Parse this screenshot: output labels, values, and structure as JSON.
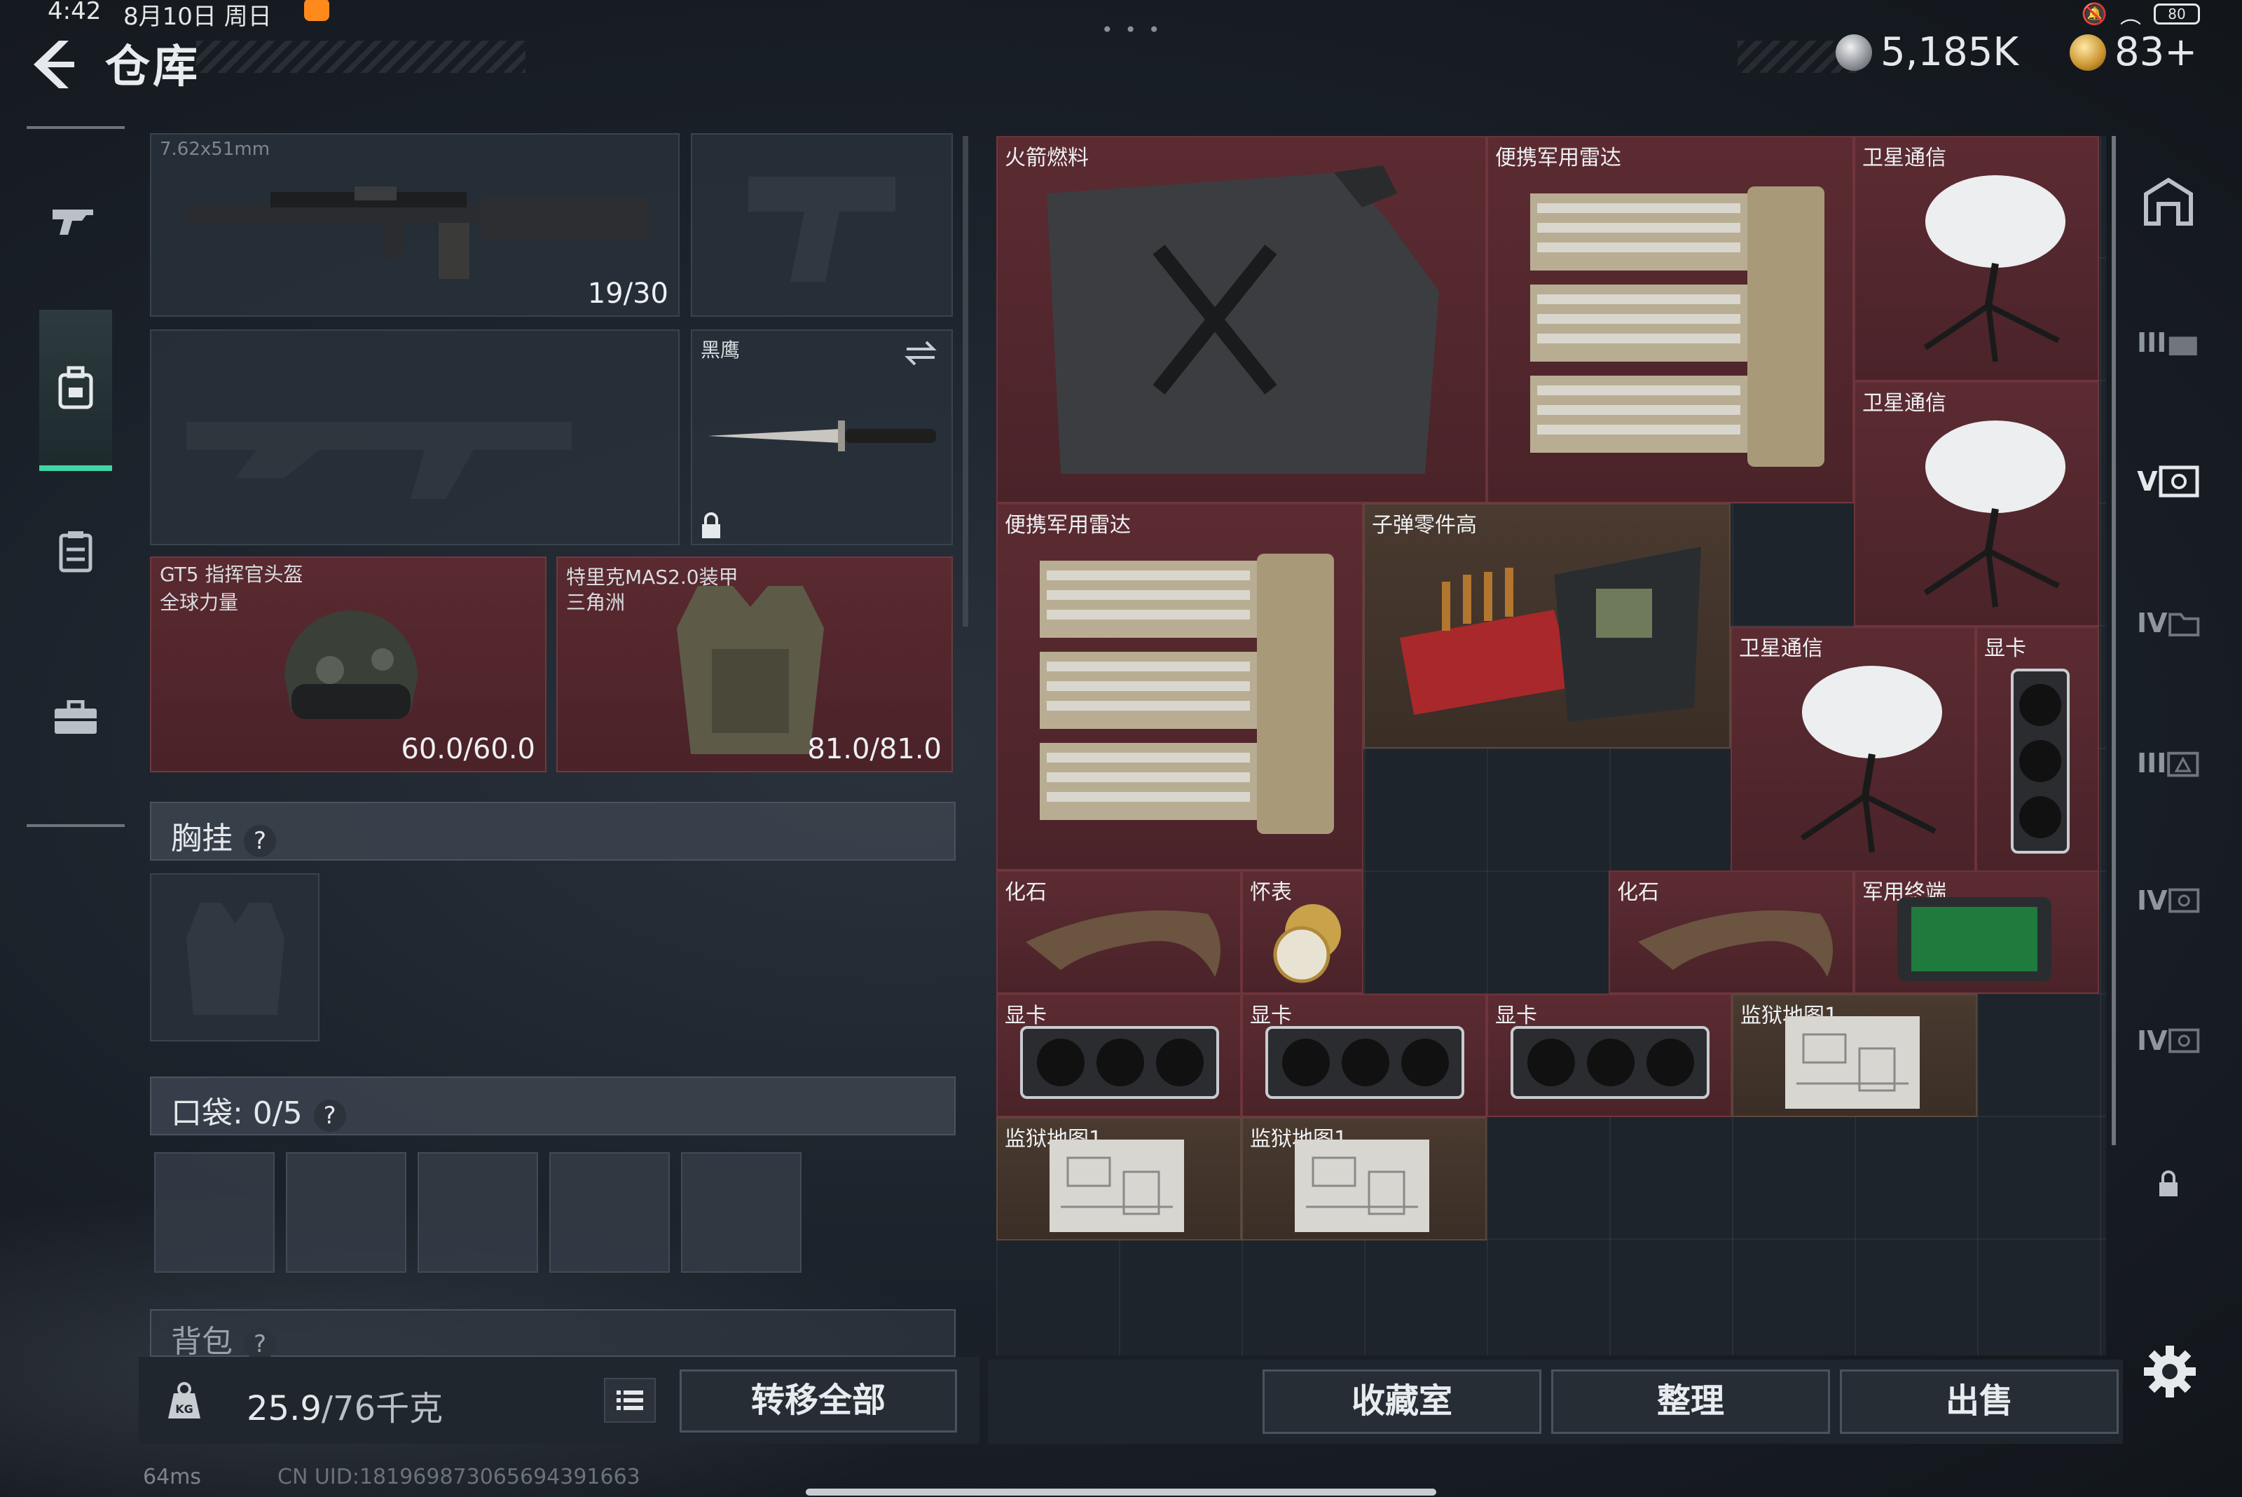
{
  "status_bar": {
    "time": "4:42",
    "date": "8月10日 周日",
    "battery": "80"
  },
  "header": {
    "title": "仓库",
    "currency_silver": "5,185K",
    "currency_gold": "83+"
  },
  "left_nav": {
    "items": [
      "gun-icon",
      "backpack-icon",
      "clipboard-icon",
      "briefcase-icon"
    ],
    "active_index": 1
  },
  "equipment": {
    "primary_weapon": {
      "caliber": "7.62x51mm",
      "ammo": "19/30"
    },
    "melee": {
      "name": "黑鹰"
    },
    "helmet": {
      "name": "GT5 指挥官头盔",
      "subtitle": "全球力量",
      "durability": "60.0/60.0"
    },
    "armor": {
      "name": "特里克MAS2.0装甲",
      "subtitle": "三角洲",
      "durability": "81.0/81.0"
    },
    "chest_rig_label": "胸挂",
    "pocket_label": "口袋: 0/5",
    "backpack_label": "背包"
  },
  "bottom_left": {
    "weight_icon_label": "KG",
    "weight_current": "25.9",
    "weight_max": "/76千克",
    "transfer_all": "转移全部"
  },
  "inventory": {
    "items": [
      {
        "label": "火箭燃料",
        "type": "fuel",
        "color": "red"
      },
      {
        "label": "便携军用雷达",
        "type": "radar",
        "color": "red"
      },
      {
        "label": "卫星通信",
        "type": "satellite",
        "color": "red"
      },
      {
        "label": "卫星通信",
        "type": "satellite",
        "color": "red"
      },
      {
        "label": "便携军用雷达",
        "type": "radar",
        "color": "red"
      },
      {
        "label": "子弹零件高",
        "type": "ammo-parts",
        "color": "brown"
      },
      {
        "label": "卫星通信",
        "type": "satellite",
        "color": "red"
      },
      {
        "label": "显卡",
        "type": "gpu-vertical",
        "color": "red"
      },
      {
        "label": "化石",
        "type": "fossil",
        "color": "red"
      },
      {
        "label": "怀表",
        "type": "pocket-watch",
        "color": "red"
      },
      {
        "label": "化石",
        "type": "fossil",
        "color": "red"
      },
      {
        "label": "军用终端",
        "type": "terminal",
        "color": "red"
      },
      {
        "label": "显卡",
        "type": "gpu",
        "color": "red"
      },
      {
        "label": "显卡",
        "type": "gpu",
        "color": "red"
      },
      {
        "label": "显卡",
        "type": "gpu",
        "color": "red"
      },
      {
        "label": "监狱地图1",
        "type": "map",
        "color": "brown"
      },
      {
        "label": "监狱地图1",
        "type": "map",
        "color": "brown"
      },
      {
        "label": "监狱地图1",
        "type": "map",
        "color": "brown"
      }
    ]
  },
  "right_nav": {
    "items": [
      "vault-icon",
      "III-rack-icon",
      "V-safe-icon",
      "IV-folder-icon",
      "III-case-icon",
      "IV-safe-icon",
      "IV-safe-icon-2",
      "lock-icon"
    ],
    "labels": [
      "",
      "III",
      "V",
      "IV",
      "III",
      "IV",
      "IV",
      ""
    ]
  },
  "bottom_right": {
    "collection": "收藏室",
    "organize": "整理",
    "sell": "出售"
  },
  "footer": {
    "ping": "64ms",
    "uid": "CN UID:1819698730656943916​63"
  },
  "colors": {
    "accent_green": "#3fd6a6",
    "item_red": "#5c2b32",
    "item_brown": "#4a3a30"
  }
}
